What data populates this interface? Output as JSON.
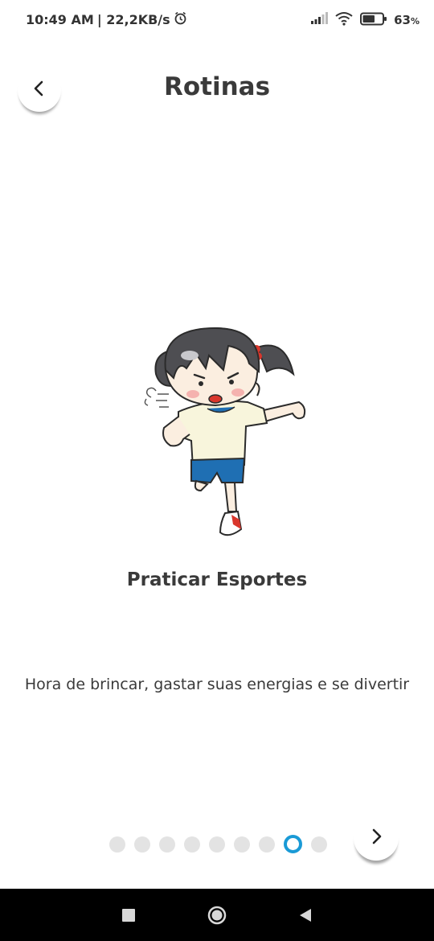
{
  "status_bar": {
    "time": "10:49 AM",
    "network_speed": "| 22,2KB/s",
    "battery_percent": "63",
    "battery_unit": "%",
    "battery_level": 0.63,
    "icons": [
      "alarm-icon",
      "signal-icon",
      "wifi-icon",
      "battery-icon"
    ]
  },
  "header": {
    "title": "Rotinas",
    "back_icon": "chevron-left-icon"
  },
  "activity": {
    "illustration": "girl-running-illustration",
    "title": "Praticar Esportes",
    "description": "Hora de brincar, gastar suas energias e se divertir"
  },
  "pager": {
    "total": 9,
    "current_index": 8,
    "next_icon": "chevron-right-icon"
  },
  "colors": {
    "accent": "#1a9ad6",
    "dot_inactive": "#e3e3e3",
    "text": "#3a3a3a"
  },
  "system_nav": [
    "recent-apps-icon",
    "home-icon",
    "back-icon"
  ]
}
